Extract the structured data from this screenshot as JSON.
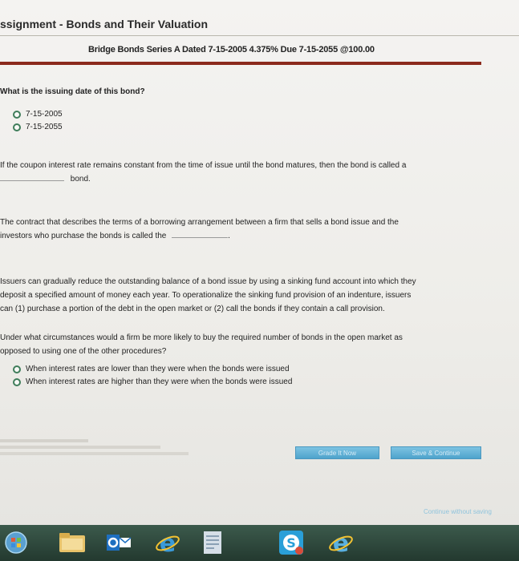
{
  "header": {
    "title": "ssignment - Bonds and Their Valuation",
    "bond_info": "Bridge Bonds Series A Dated 7-15-2005 4.375% Due 7-15-2055 @100.00"
  },
  "q1": {
    "text": "What is the issuing date of this bond?",
    "options": [
      "7-15-2005",
      "7-15-2055"
    ]
  },
  "q2": {
    "line1": "If the coupon interest rate remains constant from the time of issue until the bond matures, then the bond is called a",
    "line2": "bond."
  },
  "q3": {
    "line1": "The contract that describes the terms of a borrowing arrangement between a firm that sells a bond issue and the",
    "line2": "investors who purchase the bonds is called the",
    "tail": "."
  },
  "sinking": {
    "line1": "Issuers can gradually reduce the outstanding balance of a bond issue by using a sinking fund account into which they",
    "line2": "deposit a specified amount of money each year. To operationalize the sinking fund provision of an indenture, issuers",
    "line3": "can (1) purchase a portion of the debt in the open market or (2) call the bonds if they contain a call provision."
  },
  "q4": {
    "line1": "Under what circumstances would a firm be more likely to buy the required number of bonds in the open market as",
    "line2": "opposed to using one of the other procedures?",
    "options": [
      "When interest rates are lower than they were when the bonds were issued",
      "When interest rates are higher than they were when the bonds were issued"
    ]
  },
  "buttons": {
    "grade": "Grade It Now",
    "save": "Save & Continue",
    "continue_link": "Continue without saving"
  },
  "colors": {
    "accent_rule": "#8b2a1c",
    "button": "#5aaed6",
    "radio_ring": "#3f7d5a"
  },
  "taskbar": {
    "icons": [
      "windows-start-icon",
      "folder-icon",
      "outlook-icon",
      "internet-explorer-icon",
      "document-icon",
      "skype-icon",
      "internet-explorer-icon"
    ]
  }
}
